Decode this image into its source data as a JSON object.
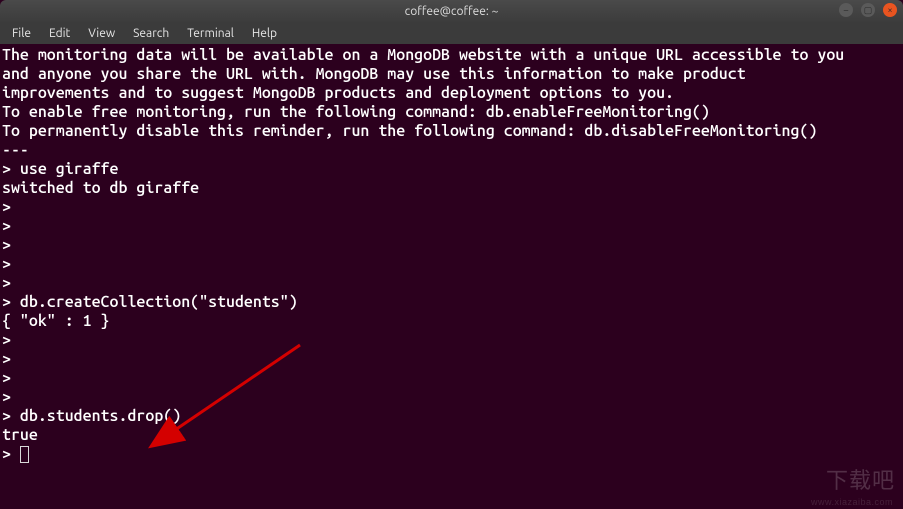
{
  "window": {
    "title": "coffee@coffee: ~"
  },
  "menu": {
    "file": "File",
    "edit": "Edit",
    "view": "View",
    "search": "Search",
    "terminal": "Terminal",
    "help": "Help"
  },
  "terminal": {
    "lines": [
      "The monitoring data will be available on a MongoDB website with a unique URL accessible to you",
      "and anyone you share the URL with. MongoDB may use this information to make product",
      "improvements and to suggest MongoDB products and deployment options to you.",
      "",
      "To enable free monitoring, run the following command: db.enableFreeMonitoring()",
      "To permanently disable this reminder, run the following command: db.disableFreeMonitoring()",
      "---",
      "",
      "> use giraffe",
      "switched to db giraffe",
      ">",
      ">",
      ">",
      ">",
      ">",
      "> db.createCollection(\"students\")",
      "{ \"ok\" : 1 }",
      ">",
      ">",
      ">",
      ">",
      "> db.students.drop()",
      "true"
    ],
    "current_prompt": "> "
  },
  "watermark": {
    "main": "下载吧",
    "sub": "www.xiazaiba.com"
  },
  "annotation": {
    "arrow_color": "#d40000"
  }
}
